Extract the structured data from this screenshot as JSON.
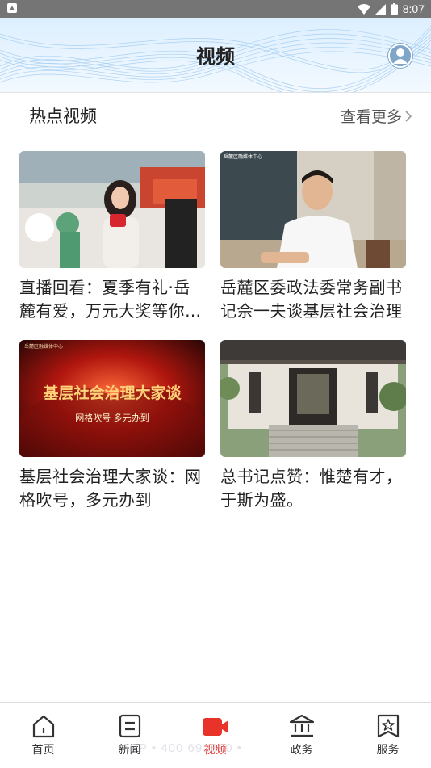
{
  "status_bar": {
    "time": "8:07"
  },
  "header": {
    "title": "视频"
  },
  "section": {
    "title": "热点视频",
    "see_more": "查看更多"
  },
  "videos": [
    {
      "caption": "直播回看：夏季有礼·岳麓有爱，万元大奖等你来拿"
    },
    {
      "caption": "岳麓区委政法委常务副书记佘一夫谈基层社会治理"
    },
    {
      "caption": "基层社会治理大家谈：网格吹号，多元办到"
    },
    {
      "caption": "总书记点赞：惟楚有才，于斯为盛。"
    }
  ],
  "thumb_text": {
    "banner_main": "基层社会治理大家谈",
    "banner_sub": "网格吹号 多元办到",
    "corner_a": "岳麓区融媒体中心",
    "corner_b": "岳麓区融媒体中心"
  },
  "bottom_nav": [
    {
      "label": "首页",
      "icon": "home-icon"
    },
    {
      "label": "新闻",
      "icon": "news-icon"
    },
    {
      "label": "视频",
      "icon": "video-icon"
    },
    {
      "label": "政务",
      "icon": "government-icon"
    },
    {
      "label": "服务",
      "icon": "service-icon"
    }
  ],
  "active_tab": "视频",
  "watermark": "APP • 400 691800 •",
  "colors": {
    "accent": "#e8322a",
    "header_bg": "#dcefff",
    "status_bar": "#757575"
  }
}
